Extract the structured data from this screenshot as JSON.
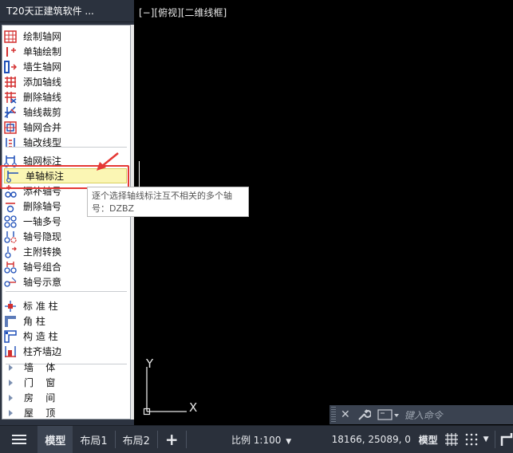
{
  "panel": {
    "title": "T20天正建筑软件 ...",
    "groups": [
      [
        "绘制轴网",
        "单轴绘制",
        "墙生轴网",
        "添加轴线",
        "删除轴线",
        "轴线裁剪",
        "轴网合并",
        "轴改线型"
      ],
      [
        "轴网标注",
        "单轴标注",
        "添补轴号",
        "删除轴号",
        "一轴多号",
        "轴号隐现",
        "主附转换",
        "轴号组合",
        "轴号示意"
      ],
      [
        "标 准 柱",
        "角    柱",
        "构 造 柱",
        "柱齐墙边"
      ]
    ],
    "categories": [
      "墙    体",
      "门    窗",
      "房    间",
      "屋    顶"
    ],
    "selected": "单轴标注",
    "icons": [
      "grid-draw-icon",
      "single-axis-icon",
      "wall-grid-icon",
      "add-axis-icon",
      "delete-axis-icon",
      "trim-axis-icon",
      "merge-grid-icon",
      "linetype-icon",
      "grid-dim-icon",
      "axis-dim-icon",
      "add-number-icon",
      "delete-number-icon",
      "multi-number-icon",
      "toggle-number-icon",
      "convert-number-icon",
      "group-number-icon",
      "number-sample-icon",
      "std-column-icon",
      "corner-column-icon",
      "struct-column-icon",
      "align-column-icon"
    ]
  },
  "viewport": {
    "label": "[−][俯视][二维线框]",
    "axis_x": "X",
    "axis_y": "Y"
  },
  "tooltip": {
    "line1": "逐个选择轴线标注互不相关的多个轴",
    "line2": "号：DZBZ"
  },
  "cmdbar": {
    "placeholder": "键入命令"
  },
  "statusbar": {
    "tabs": [
      "模型",
      "布局1",
      "布局2"
    ],
    "active_tab": "模型",
    "add_tab": "+",
    "scale": "比例 1:100",
    "coords": "18166, 25089, 0",
    "mode": "模型"
  },
  "colors": {
    "accent_red": "#e53935",
    "icon_red": "#d32f2f",
    "icon_blue": "#1e4fb8"
  }
}
